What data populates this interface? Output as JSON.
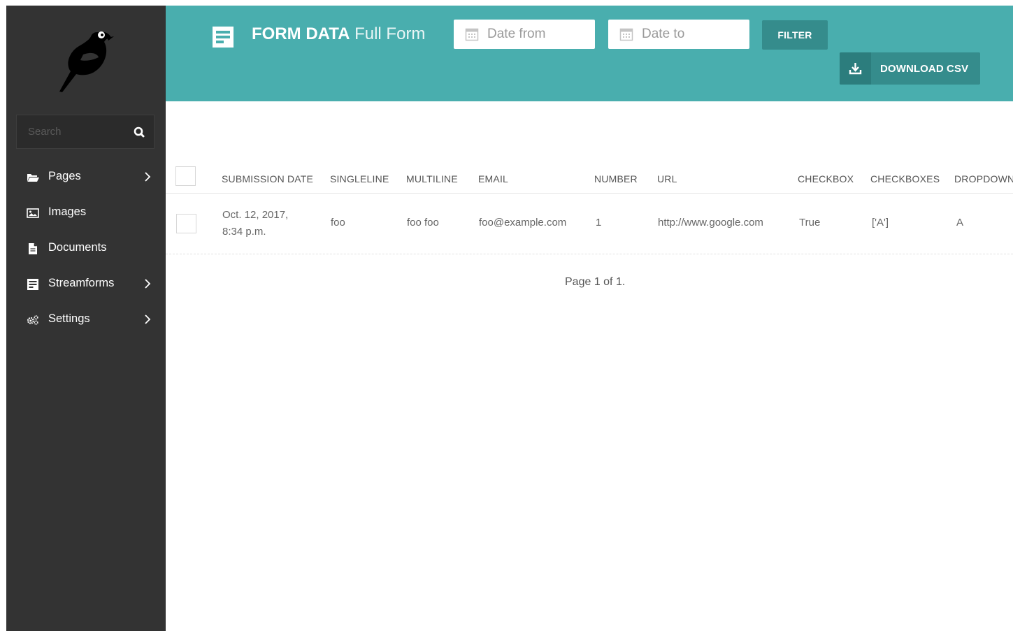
{
  "sidebar": {
    "search_placeholder": "Search",
    "items": [
      {
        "label": "Pages",
        "icon": "folder-open-icon",
        "has_children": true
      },
      {
        "label": "Images",
        "icon": "image-icon",
        "has_children": false
      },
      {
        "label": "Documents",
        "icon": "document-icon",
        "has_children": false
      },
      {
        "label": "Streamforms",
        "icon": "form-icon",
        "has_children": true
      },
      {
        "label": "Settings",
        "icon": "cogs-icon",
        "has_children": true
      }
    ]
  },
  "header": {
    "title_strong": "FORM DATA",
    "title_light": "Full Form",
    "date_from_placeholder": "Date from",
    "date_to_placeholder": "Date to",
    "filter_label": "FILTER",
    "download_label": "DOWNLOAD CSV"
  },
  "table": {
    "columns": [
      "SUBMISSION DATE",
      "SINGLELINE",
      "MULTILINE",
      "EMAIL",
      "NUMBER",
      "URL",
      "CHECKBOX",
      "CHECKBOXES",
      "DROPDOWN"
    ],
    "rows": [
      {
        "submission_date_line1": "Oct. 12, 2017,",
        "submission_date_line2": "8:34 p.m.",
        "singleline": "foo",
        "multiline": "foo foo",
        "email": "foo@example.com",
        "number": "1",
        "url": "http://www.google.com",
        "checkbox": "True",
        "checkboxes": "['A']",
        "dropdown": "A"
      }
    ]
  },
  "pagination": {
    "text": "Page 1 of 1."
  },
  "colors": {
    "sidebar_bg": "#333333",
    "header_bg": "#49aeae",
    "button_bg": "#358c8c"
  }
}
